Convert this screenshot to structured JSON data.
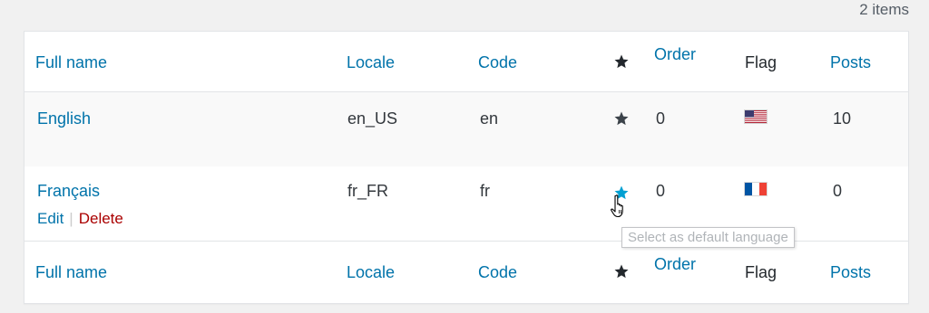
{
  "items_count": "2 items",
  "columns": {
    "full_name": "Full name",
    "locale": "Locale",
    "code": "Code",
    "order": "Order",
    "flag": "Flag",
    "posts": "Posts"
  },
  "rows": [
    {
      "full_name": "English",
      "locale": "en_US",
      "code": "en",
      "order": "0",
      "flag_icon": "us-flag-icon",
      "posts": "10",
      "is_default": true
    },
    {
      "full_name": "Français",
      "locale": "fr_FR",
      "code": "fr",
      "order": "0",
      "flag_icon": "fr-flag-icon",
      "posts": "0",
      "is_default": false,
      "actions": {
        "edit": "Edit",
        "delete": "Delete"
      }
    }
  ],
  "tooltip": "Select as default language",
  "colors": {
    "link": "#0073aa",
    "delete": "#aa0000",
    "star_default": "#23282d",
    "star_hover": "#00a0d2"
  }
}
